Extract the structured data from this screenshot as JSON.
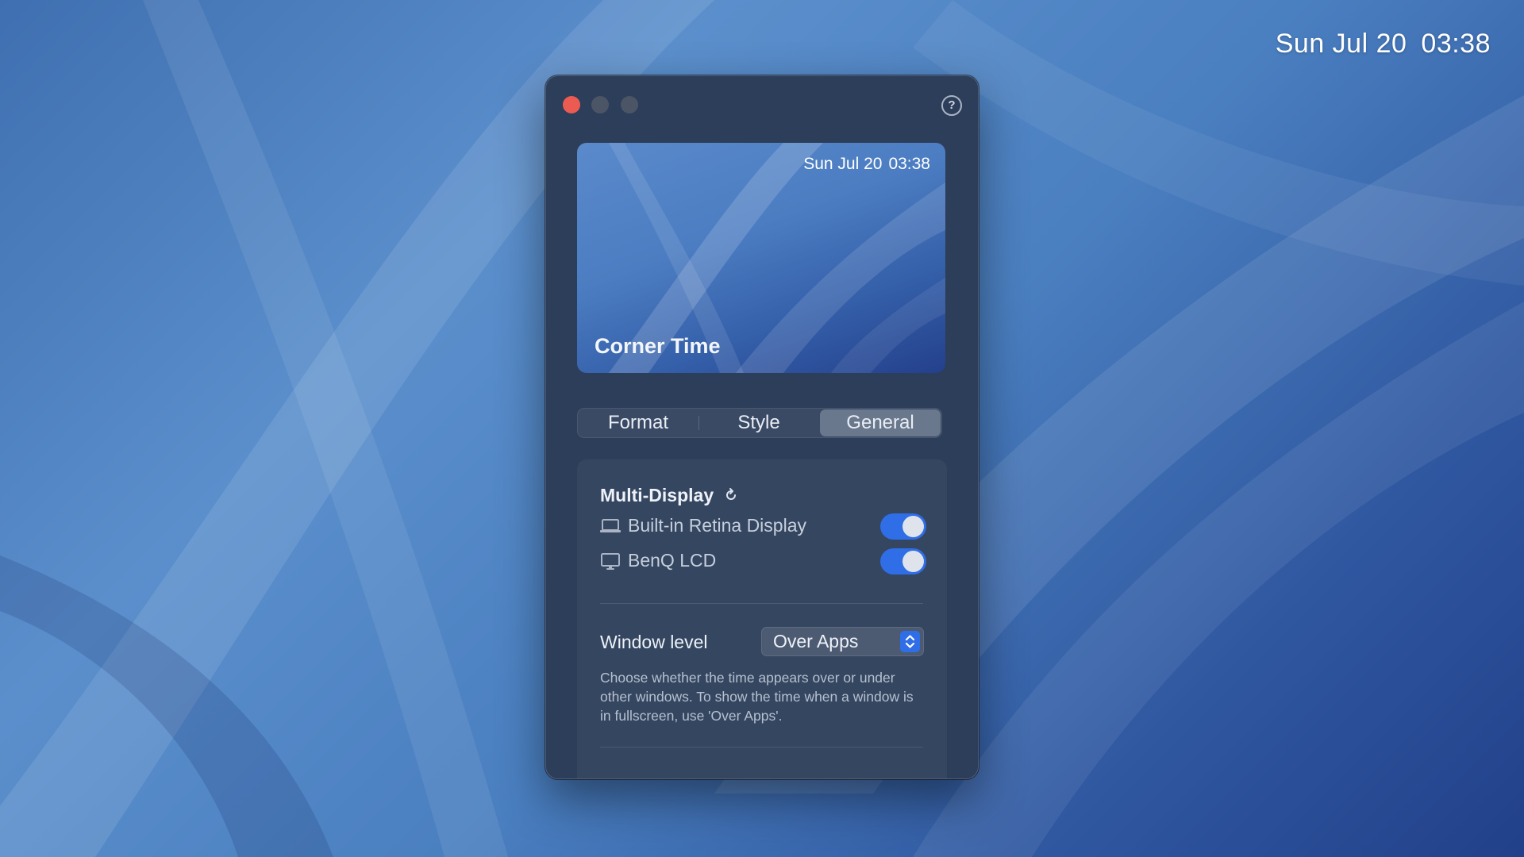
{
  "desktop": {
    "clock": {
      "date": "Sun Jul 20",
      "time": "03:38"
    }
  },
  "window": {
    "help_label": "?",
    "preview": {
      "clock": {
        "date": "Sun Jul 20",
        "time": "03:38"
      },
      "title": "Corner Time"
    },
    "tabs": [
      {
        "label": "Format",
        "active": false
      },
      {
        "label": "Style",
        "active": false
      },
      {
        "label": "General",
        "active": true
      }
    ],
    "multi_display": {
      "title": "Multi-Display",
      "displays": [
        {
          "label": "Built-in Retina Display",
          "icon": "laptop-icon",
          "enabled": true
        },
        {
          "label": "BenQ LCD",
          "icon": "monitor-icon",
          "enabled": true
        }
      ]
    },
    "window_level": {
      "label": "Window level",
      "value": "Over Apps",
      "description": "Choose whether the time appears over or under other windows. To show the time when a window is in fullscreen, use 'Over Apps'."
    }
  },
  "colors": {
    "accent": "#2f6ee6",
    "close_button": "#ec5b52",
    "window_bg": "#2d3e5a"
  }
}
